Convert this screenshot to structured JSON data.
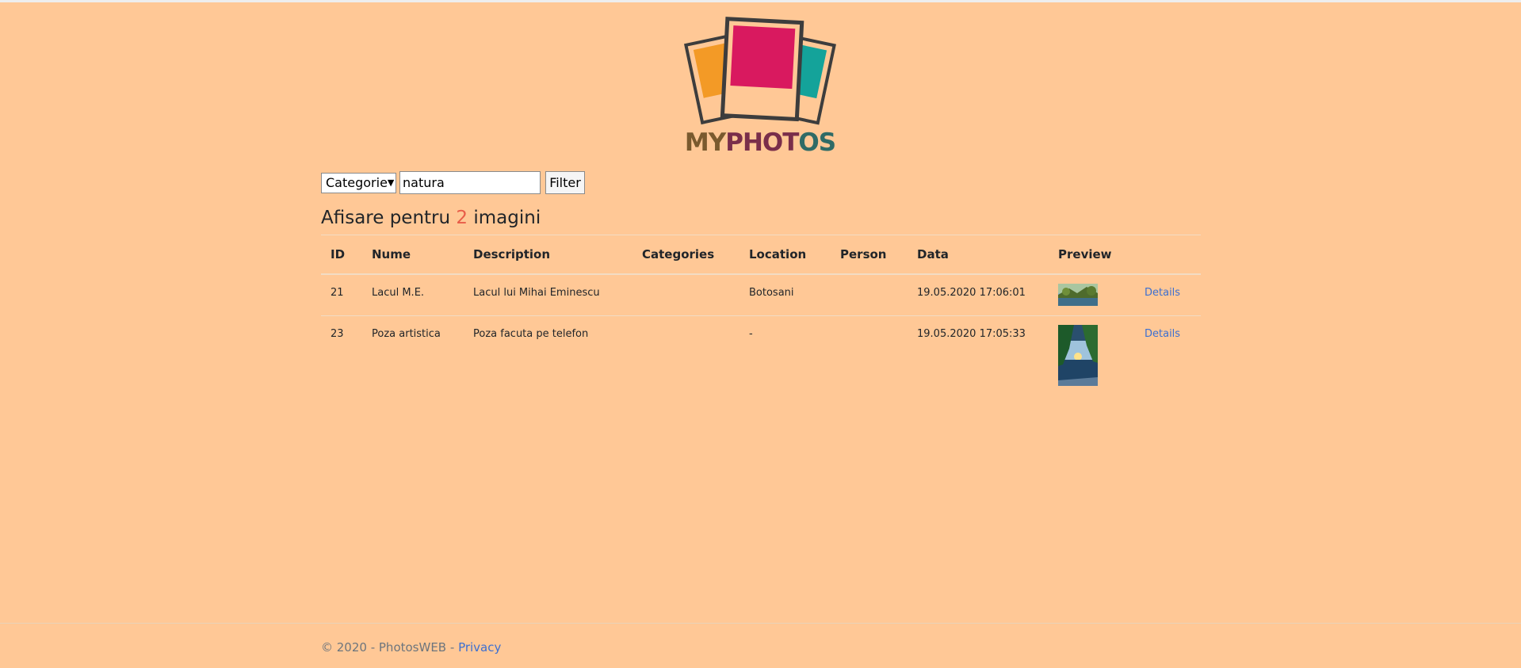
{
  "brand": {
    "logo_text_my": "MY",
    "logo_text_phot": "PHOT",
    "logo_text_os": "OS"
  },
  "filter": {
    "select_value": "Categorie",
    "search_value": "natura",
    "button_label": "Filter"
  },
  "heading": {
    "prefix": "Afisare pentru",
    "count": "2",
    "suffix": "imagini"
  },
  "table": {
    "headers": {
      "id": "ID",
      "nume": "Nume",
      "description": "Description",
      "categories": "Categories",
      "location": "Location",
      "person": "Person",
      "data": "Data",
      "preview": "Preview"
    },
    "rows": [
      {
        "id": "21",
        "nume": "Lacul M.E.",
        "description": "Lacul lui Mihai Eminescu",
        "categories": "",
        "location": "Botosani",
        "person": "",
        "data": "19.05.2020 17:06:01",
        "details": "Details"
      },
      {
        "id": "23",
        "nume": "Poza artistica",
        "description": "Poza facuta pe telefon",
        "categories": "",
        "location": "-",
        "person": "",
        "data": "19.05.2020 17:05:33",
        "details": "Details"
      }
    ]
  },
  "footer": {
    "text": "© 2020 - PhotosWEB -",
    "privacy_link": "Privacy"
  },
  "colors": {
    "background": "#ffc896",
    "count_accent": "#e85c48",
    "link": "#3c6fd1"
  }
}
